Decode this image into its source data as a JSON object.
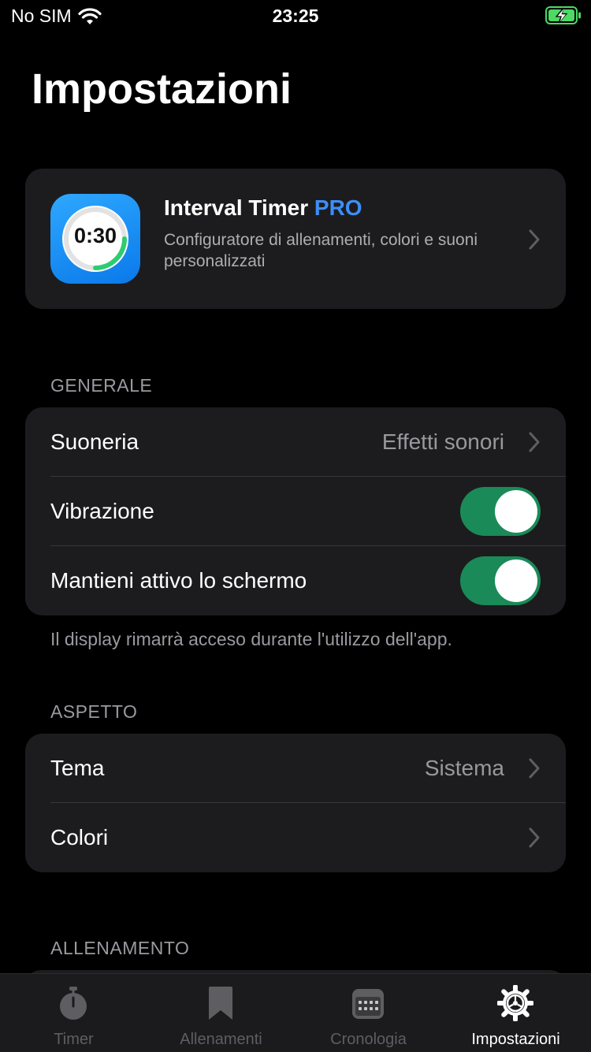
{
  "status_bar": {
    "carrier": "No SIM",
    "time": "23:25"
  },
  "page_title": "Impostazioni",
  "pro_card": {
    "icon_time": "0:30",
    "title": "Interval Timer",
    "title_badge": "PRO",
    "description": "Configuratore di allenamenti, colori e suoni personalizzati"
  },
  "generale": {
    "header": "GENERALE",
    "rows": [
      {
        "label": "Suoneria",
        "value": "Effetti sonori"
      },
      {
        "label": "Vibrazione",
        "toggle": true
      },
      {
        "label": "Mantieni attivo lo schermo",
        "toggle": true
      }
    ],
    "footnote": "Il display rimarrà acceso durante l'utilizzo dell'app."
  },
  "aspetto": {
    "header": "ASPETTO",
    "rows": [
      {
        "label": "Tema",
        "value": "Sistema"
      },
      {
        "label": "Colori"
      }
    ]
  },
  "allenamento": {
    "header": "ALLENAMENTO"
  },
  "tab_bar": {
    "tabs": [
      {
        "label": "Timer",
        "icon": "stopwatch-icon",
        "active": false
      },
      {
        "label": "Allenamenti",
        "icon": "bookmark-icon",
        "active": false
      },
      {
        "label": "Cronologia",
        "icon": "calendar-icon",
        "active": false
      },
      {
        "label": "Impostazioni",
        "icon": "gear-icon",
        "active": true
      }
    ]
  },
  "colors": {
    "accent_pro": "#3d8ef7",
    "toggle_on": "#1a8a58",
    "background": "#000000",
    "card": "#1c1c1e"
  }
}
